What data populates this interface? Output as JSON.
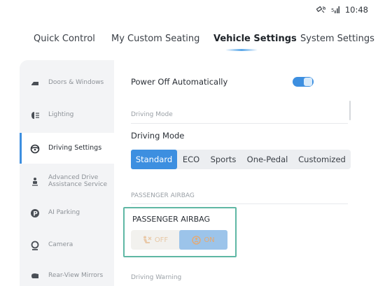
{
  "status": {
    "time": "10:48"
  },
  "tabs": [
    {
      "label": "Quick Control"
    },
    {
      "label": "My Custom Seating"
    },
    {
      "label": "Vehicle Settings"
    },
    {
      "label": "System Settings"
    }
  ],
  "sidebar": {
    "items": [
      {
        "label": "Doors & Windows",
        "icon": "door-window-icon"
      },
      {
        "label": "Lighting",
        "icon": "headlight-icon"
      },
      {
        "label": "Driving Settings",
        "icon": "steering-wheel-icon"
      },
      {
        "label": "Advanced Drive Assistance Service",
        "icon": "driver-assist-icon"
      },
      {
        "label": "AI Parking",
        "icon": "parking-icon"
      },
      {
        "label": "Camera",
        "icon": "camera-icon"
      },
      {
        "label": "Rear-View Mirrors",
        "icon": "mirror-icon"
      }
    ]
  },
  "content": {
    "power_off_label": "Power Off Automatically",
    "power_off_enabled": true,
    "driving_mode_section": "Driving Mode",
    "driving_mode_label": "Driving Mode",
    "driving_modes": [
      "Standard",
      "ECO",
      "Sports",
      "One-Pedal",
      "Customized"
    ],
    "driving_mode_selected": "Standard",
    "airbag_section": "PASSENGER AIRBAG",
    "airbag_label": "PASSENGER AIRBAG",
    "airbag_off": "OFF",
    "airbag_on": "ON",
    "airbag_selected": "ON",
    "driving_warning_section": "Driving Warning"
  },
  "colors": {
    "accent": "#3d8fe0",
    "highlight_border": "#5fb7a4",
    "airbag_on_bg": "#9cc4ea",
    "airbag_text": "#e9a86c"
  }
}
